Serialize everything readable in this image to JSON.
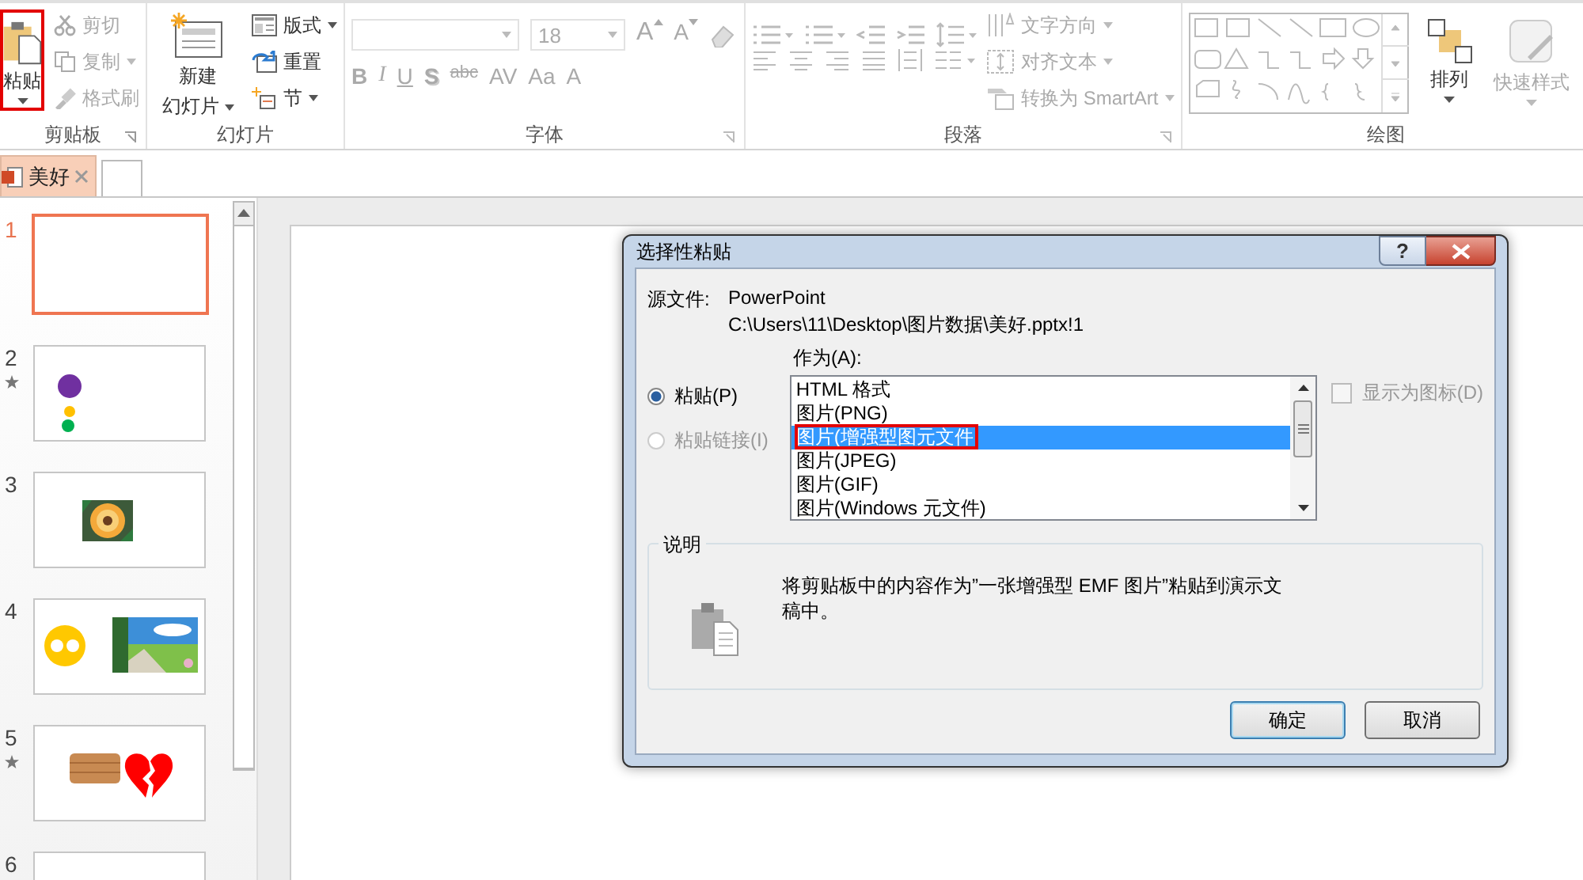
{
  "ribbon": {
    "clipboard": {
      "label": "剪贴板",
      "paste": {
        "label": "粘贴",
        "highlighted": true
      },
      "items": [
        {
          "label": "剪切",
          "disabled": true,
          "dropdown": false
        },
        {
          "label": "复制",
          "disabled": true,
          "dropdown": true
        },
        {
          "label": "格式刷",
          "disabled": true,
          "dropdown": false
        }
      ]
    },
    "slides": {
      "label": "幻灯片",
      "new_slide": {
        "lines": [
          "新建",
          "幻灯片"
        ]
      },
      "items": [
        {
          "label": "版式",
          "disabled": false,
          "dropdown": true
        },
        {
          "label": "重置",
          "disabled": false,
          "dropdown": false
        },
        {
          "label": "节",
          "disabled": false,
          "dropdown": true
        }
      ]
    },
    "font": {
      "label": "字体",
      "disabled": true,
      "size": "18",
      "grow": "A",
      "shrink": "A",
      "buttons": [
        "B",
        "I",
        "U",
        "S",
        "abc",
        "AV",
        "Aa",
        "A"
      ]
    },
    "paragraph": {
      "label": "段落",
      "disabled": true,
      "items": [
        {
          "label": "文字方向",
          "dropdown": true
        },
        {
          "label": "对齐文本",
          "dropdown": true
        },
        {
          "label": "转换为 SmartArt",
          "dropdown": true
        }
      ]
    },
    "drawing": {
      "label": "绘图",
      "arrange": {
        "label": "排列",
        "disabled": false
      },
      "quick_styles": {
        "label": "快速样式",
        "disabled": true
      }
    }
  },
  "document_tabs": [
    {
      "label": "美好",
      "selected": true
    }
  ],
  "slides": [
    {
      "number": "1",
      "selected": true,
      "animated": false,
      "kind": "blank"
    },
    {
      "number": "2",
      "selected": false,
      "animated": true,
      "kind": "dots"
    },
    {
      "number": "3",
      "selected": false,
      "animated": false
    },
    {
      "number": "4",
      "selected": false,
      "animated": false,
      "kind": "circle-photo"
    },
    {
      "number": "5",
      "selected": false,
      "animated": true,
      "kind": "wood-heart"
    },
    {
      "number": "6",
      "selected": false,
      "animated": false,
      "kind": "blank"
    }
  ],
  "dialog": {
    "title": "选择性粘贴",
    "help": "?",
    "source_label": "源文件:",
    "source_app": "PowerPoint",
    "source_path": "C:\\Users\\11\\Desktop\\图片数据\\美好.pptx!1",
    "as_label": "作为(A):",
    "paste_options": [
      {
        "label": "粘贴(P)",
        "selected": true,
        "disabled": false
      },
      {
        "label": "粘贴链接(I)",
        "selected": false,
        "disabled": true
      }
    ],
    "formats": [
      {
        "label": "HTML 格式",
        "selected": false,
        "highlighted": false
      },
      {
        "label": "图片(PNG)",
        "selected": false,
        "highlighted": false
      },
      {
        "label": "图片(增强型图元文件",
        "selected": true,
        "highlighted": true
      },
      {
        "label": "图片(JPEG)",
        "selected": false,
        "highlighted": false
      },
      {
        "label": "图片(GIF)",
        "selected": false,
        "highlighted": false
      },
      {
        "label": "图片(Windows 元文件)",
        "selected": false,
        "highlighted": false
      }
    ],
    "display_as_icon": {
      "label": "显示为图标(D)",
      "checked": false,
      "disabled": true
    },
    "description": {
      "label": "说明",
      "text": "将剪贴板中的内容作为”一张增强型 EMF 图片”粘贴到演示文稿中。"
    },
    "buttons": [
      {
        "label": "确定",
        "default": true
      },
      {
        "label": "取消",
        "default": false
      }
    ]
  }
}
